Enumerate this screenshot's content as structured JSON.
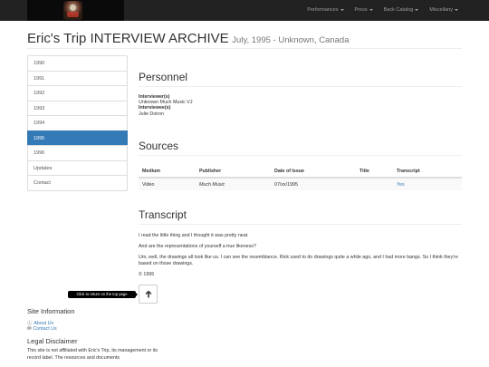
{
  "nav": {
    "items": [
      {
        "label": "Performances"
      },
      {
        "label": "Press"
      },
      {
        "label": "Back Catalog"
      },
      {
        "label": "Miscellany"
      }
    ]
  },
  "header": {
    "title": "Eric's Trip INTERVIEW ARCHIVE",
    "subtitle": "July, 1995 - Unknown, Canada"
  },
  "sidebar": {
    "items": [
      {
        "label": "1990"
      },
      {
        "label": "1991"
      },
      {
        "label": "1992"
      },
      {
        "label": "1993"
      },
      {
        "label": "1994"
      },
      {
        "label": "1995"
      },
      {
        "label": "1996"
      },
      {
        "label": "Updates"
      },
      {
        "label": "Contact"
      }
    ]
  },
  "personnel": {
    "heading": "Personnel",
    "interviewer_label": "Interviewer(s)",
    "interviewer": "Unknown Much Music VJ",
    "interviewee_label": "Interviewee(s)",
    "interviewee": "Julie Doiron"
  },
  "sources": {
    "heading": "Sources",
    "columns": [
      "Medium",
      "Publisher",
      "Date of Issue",
      "Title",
      "Transcript"
    ],
    "row": {
      "medium": "Video",
      "publisher": "Much Music",
      "date": "07/xx/1995",
      "title": "",
      "transcript": "Yes"
    }
  },
  "transcript": {
    "heading": "Transcript",
    "paragraphs": [
      "I read the little thing and I thought it was pretty neat.",
      "And are the representations of yourself a true likeness?",
      "Um, well, the drawings all look like us. I can see the resemblance. Rick used to do drawings quite a while ago, and I had more bangs. So I think they're based on those drawings.",
      "© 1995"
    ]
  },
  "tooltip": "Click to return on the top page",
  "footer": {
    "site_info": "Site Information",
    "about": "About Us",
    "contact": "Contact Us",
    "legal": "Legal Disclaimer",
    "disclaimer": "This site is not affiliated with Eric's Trip, its management or its record label. The resources and documents"
  }
}
